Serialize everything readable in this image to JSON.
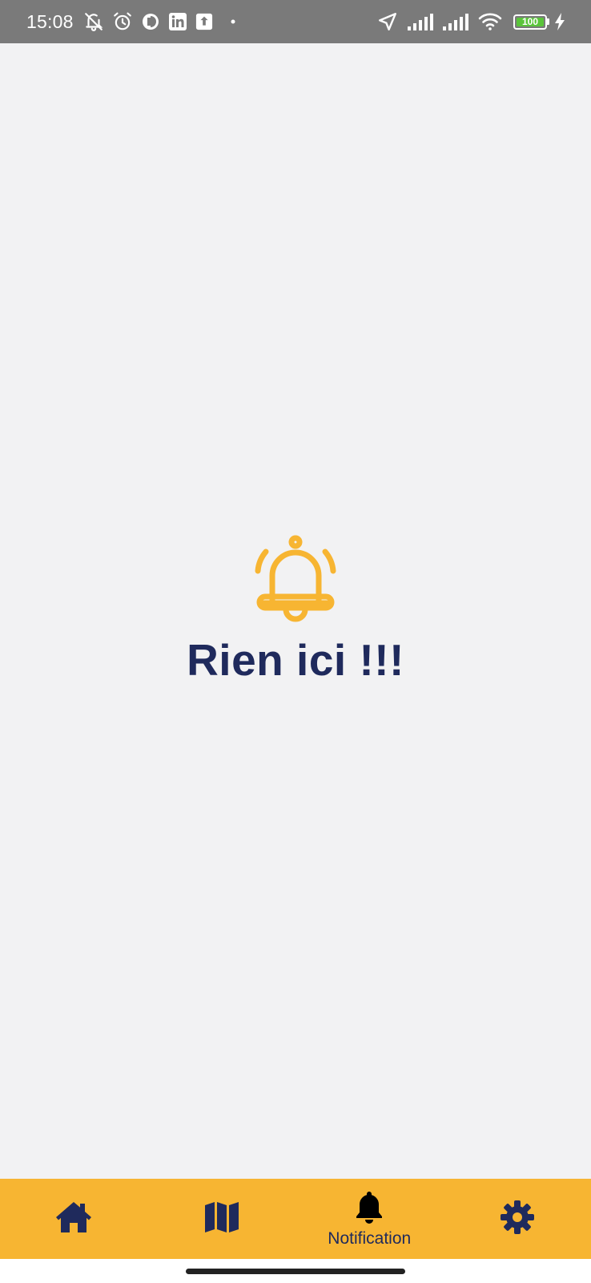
{
  "status_bar": {
    "time": "15:08",
    "battery": "100",
    "left_icons": [
      "bell-off-icon",
      "alarm-icon",
      "app-icon",
      "linkedin-icon",
      "upload-icon",
      "dot-icon"
    ],
    "right_icons": [
      "location-arrow-icon",
      "signal-icon",
      "signal-icon",
      "wifi-icon",
      "battery-icon",
      "charging-icon"
    ]
  },
  "main": {
    "empty_icon": "bell-icon",
    "empty_message": "Rien ici !!!"
  },
  "bottom_nav": {
    "items": [
      {
        "icon": "home-icon",
        "label": ""
      },
      {
        "icon": "map-icon",
        "label": ""
      },
      {
        "icon": "bell-icon",
        "label": "Notification",
        "active": true
      },
      {
        "icon": "gear-icon",
        "label": ""
      }
    ]
  },
  "colors": {
    "accent": "#f7b532",
    "primary": "#1f2a5c",
    "background": "#f2f2f3",
    "status_bar": "#7a7a7a",
    "battery_green": "#5ac43a"
  }
}
